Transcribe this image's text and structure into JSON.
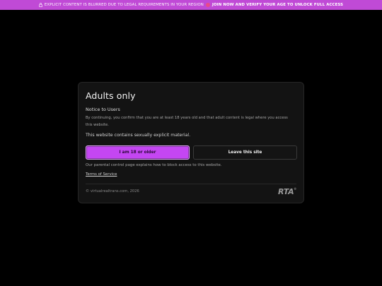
{
  "banner": {
    "notice": "EXPLICIT CONTENT IS BLURRED DUE TO LEGAL REQUIREMENTS IN YOUR REGION",
    "cta": "JOIN NOW AND VERIFY YOUR AGE TO UNLOCK FULL ACCESS",
    "icon_left": "lock-icon",
    "icon_mid": "age-badge-icon",
    "bg_color": "#c04ad6"
  },
  "modal": {
    "title": "Adults only",
    "notice_heading": "Notice to Users",
    "consent_text": "By continuing, you confirm that you are at least 18 years old and that adult content is legal where you access this website.",
    "explicit_text": "This website contains sexually explicit material.",
    "confirm_button": "I am 18 or older",
    "leave_button": "Leave this site",
    "parental_text": "Our parental control page explains how to block access to this website.",
    "tos_link": "Terms of Service",
    "copyright": "© virtualrealtrans.com, 2026",
    "logo_text": "RTA",
    "logo_reg": "®",
    "accent_color": "#c446f2"
  }
}
